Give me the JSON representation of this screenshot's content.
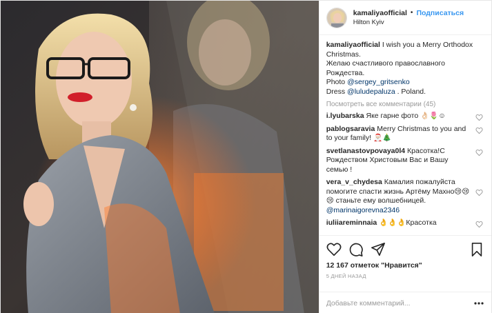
{
  "header": {
    "username": "kamaliyaofficial",
    "separator": "•",
    "follow_label": "Подписаться",
    "location": "Hilton Kyiv"
  },
  "caption": {
    "username": "kamaliyaofficial",
    "line1": "I wish you a Merry Orthodox Christmas.",
    "line2": "Желаю счастливого православного Рождества.",
    "photo_prefix": "Photo",
    "photo_mention": "@sergey_gritsenko",
    "dress_prefix": "Dress",
    "dress_mention": "@luludepaluza",
    "dress_suffix": ". Poland."
  },
  "view_all": "Посмотреть все комментарии (45)",
  "comments": [
    {
      "user": "i.lyubarska",
      "text": "Яке гарне фото 👌🏻🌷☺"
    },
    {
      "user": "pablogsaravia",
      "text": "Merry Christmas to you and to your family! 🎅🏻🎄"
    },
    {
      "user": "svetlanastovpovaya0l4",
      "text": "Красотка!С Рождеством Христовым Вас и Вашу семью !"
    },
    {
      "user": "vera_v_chydesa",
      "text": "Камалия пожалуйста помогите спасти жизнь Артёму Махно😢😢😢 станьте ему волшебницей.",
      "mention": "@marinaigorevna2346"
    },
    {
      "user": "iuliiareminnaia",
      "text": "👌👌👌Красотка"
    }
  ],
  "likes": "12 167 отметок \"Нравится\"",
  "timestamp": "5 дней назад",
  "add_comment_placeholder": "Добавьте комментарий...",
  "colors": {
    "link": "#3897f0",
    "mention": "#003569",
    "muted": "#999999",
    "text": "#262626"
  },
  "icons": [
    "heart-icon",
    "comment-icon",
    "share-icon",
    "bookmark-icon",
    "more-dots-icon"
  ]
}
